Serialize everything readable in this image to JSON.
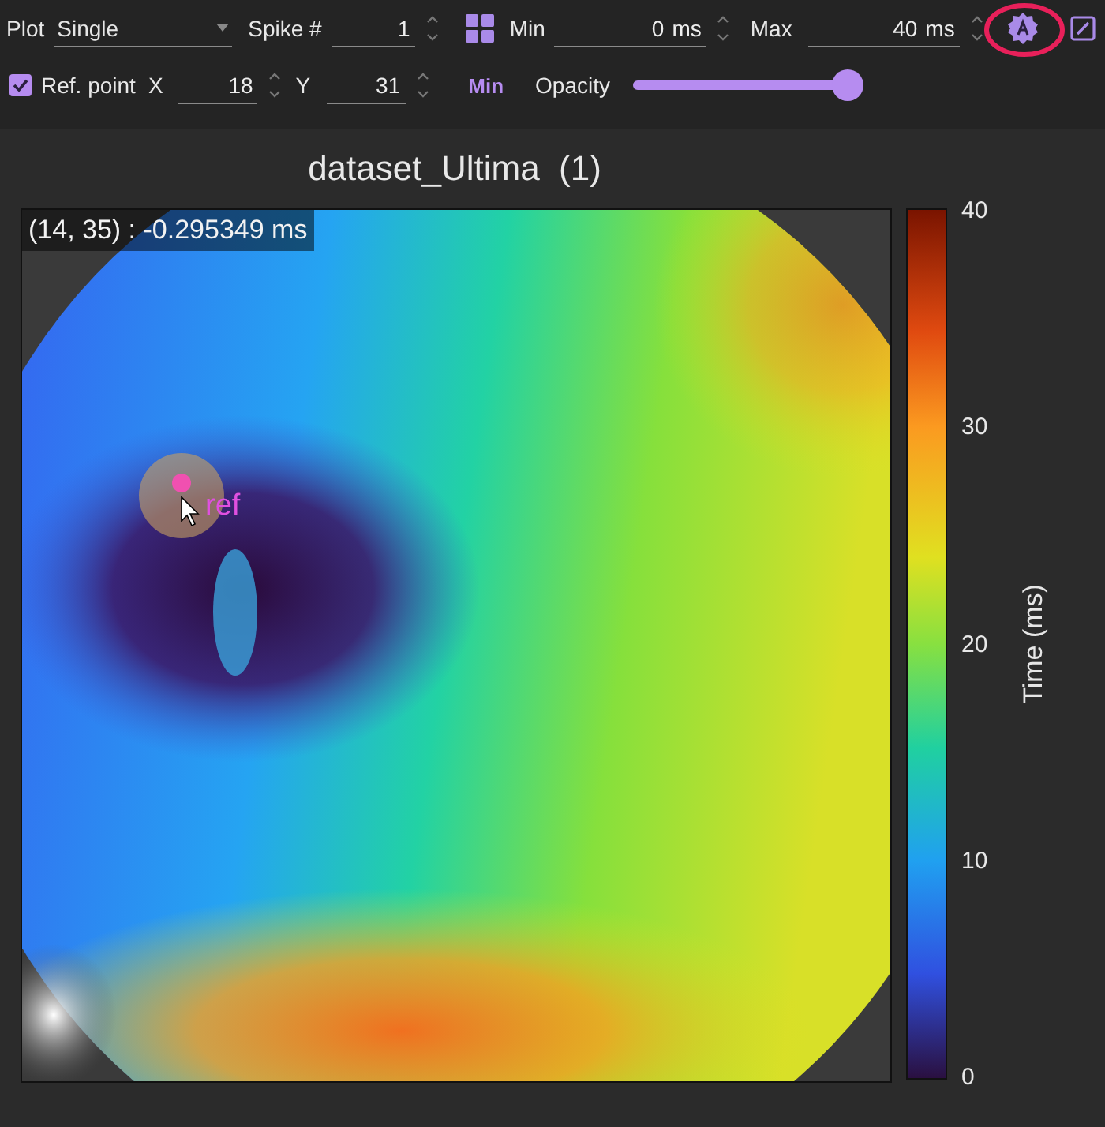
{
  "toolbar": {
    "plot": {
      "label": "Plot",
      "value": "Single"
    },
    "spike": {
      "label": "Spike #",
      "value": "1"
    },
    "min": {
      "label": "Min",
      "value": "0",
      "unit": "ms"
    },
    "max": {
      "label": "Max",
      "value": "40",
      "unit": "ms"
    },
    "ref_point": {
      "label": "Ref. point",
      "checked": true
    },
    "x": {
      "label": "X",
      "value": "18"
    },
    "y": {
      "label": "Y",
      "value": "31"
    },
    "min_button": "Min",
    "opacity": {
      "label": "Opacity",
      "level": 1
    }
  },
  "plot": {
    "title": "dataset_Ultima  (1)",
    "hover_readout": "(14, 35) : -0.295349 ms",
    "ref_label": "ref",
    "colorbar": {
      "label": "Time (ms)",
      "ticks": [
        "40",
        "30",
        "20",
        "10",
        "0"
      ]
    }
  }
}
